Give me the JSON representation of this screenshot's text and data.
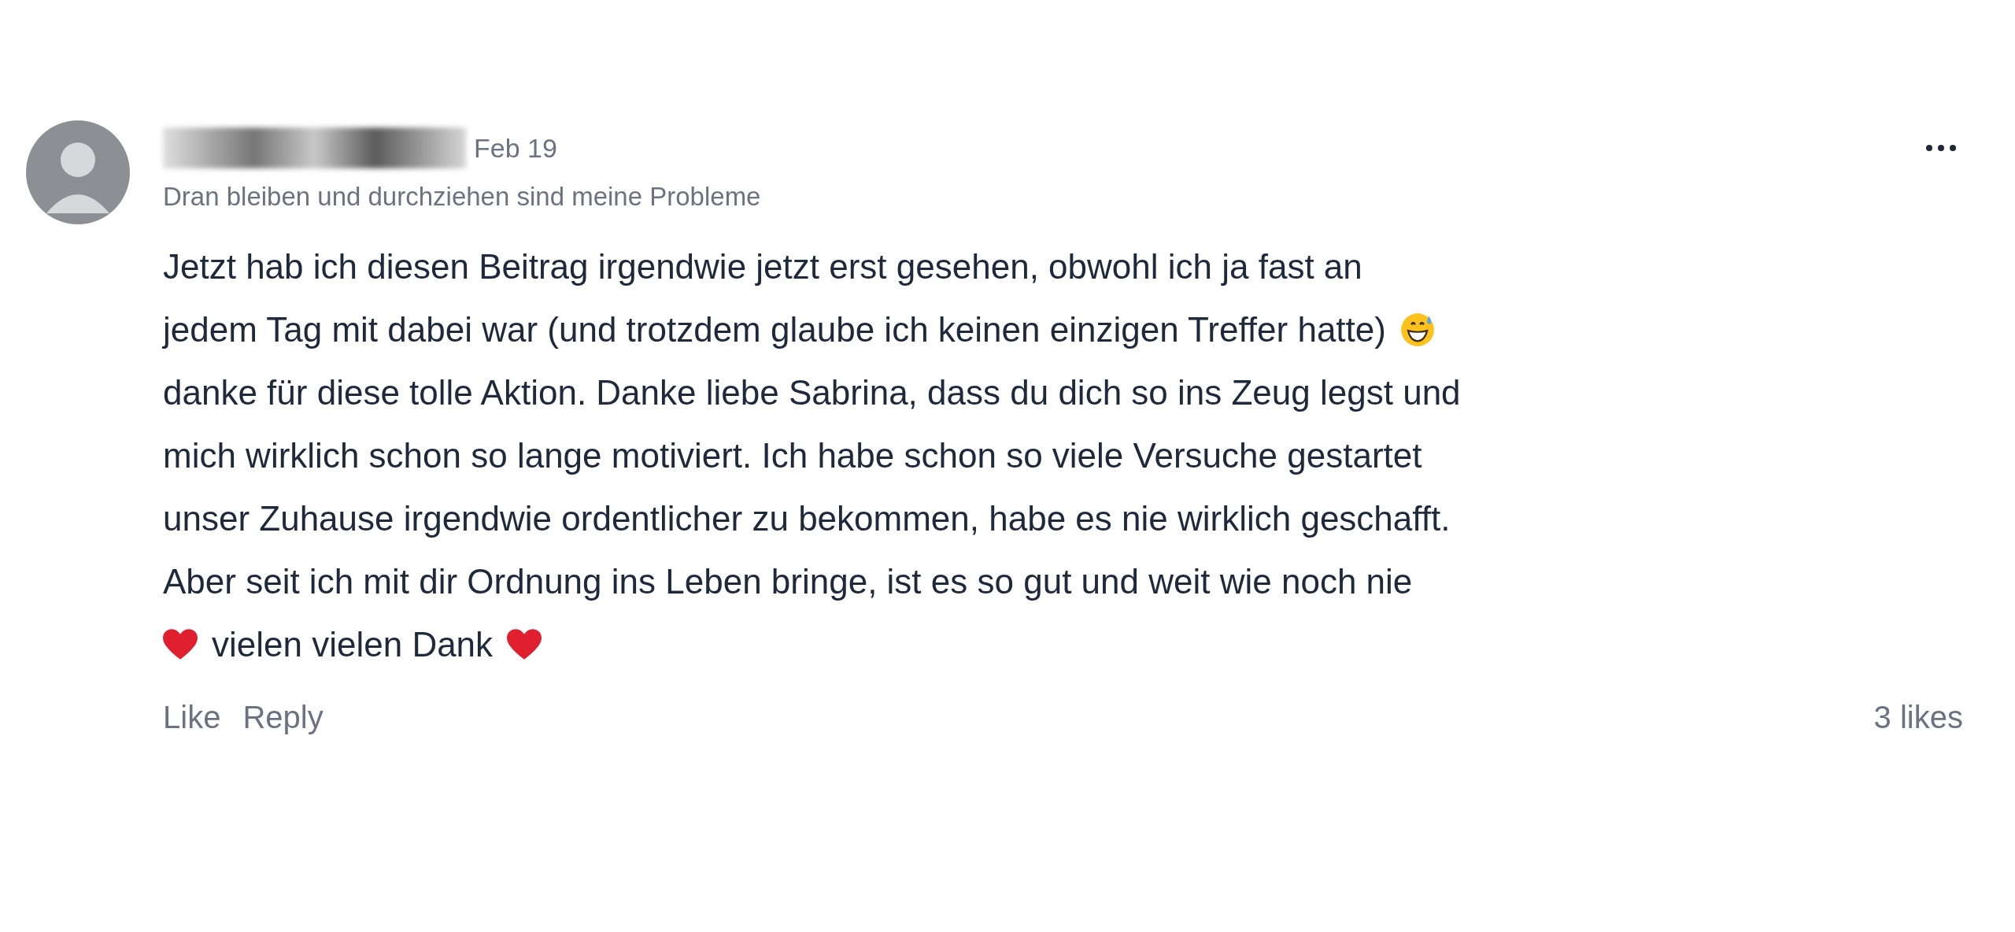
{
  "comment": {
    "author": {
      "kind": "redacted"
    },
    "date": "Feb 19",
    "tagline": "Dran bleiben und durchziehen sind meine Probleme",
    "body": [
      [
        {
          "kind": "text",
          "text": "Jetzt hab ich diesen Beitrag irgendwie jetzt erst gesehen, obwohl ich ja fast an"
        }
      ],
      [
        {
          "kind": "text",
          "text": "jedem Tag mit dabei war (und trotzdem glaube ich keinen einzigen Treffer hatte)"
        },
        {
          "kind": "sweat-smile"
        }
      ],
      [
        {
          "kind": "text",
          "text": "danke für diese tolle Aktion. Danke liebe Sabrina, dass du dich so ins Zeug legst und"
        }
      ],
      [
        {
          "kind": "text",
          "text": "mich wirklich schon so lange motiviert. Ich habe schon so viele Versuche gestartet"
        }
      ],
      [
        {
          "kind": "text",
          "text": "unser Zuhause irgendwie ordentlicher zu bekommen, habe es nie wirklich geschafft."
        }
      ],
      [
        {
          "kind": "text",
          "text": "Aber seit ich mit dir Ordnung ins Leben bringe, ist es so gut und weit wie noch nie"
        }
      ],
      [
        {
          "kind": "heart"
        },
        {
          "kind": "text",
          "text": "vielen vielen Dank"
        },
        {
          "kind": "heart"
        }
      ]
    ],
    "actions": [
      "Like",
      "Reply"
    ],
    "likes": "3 likes"
  }
}
